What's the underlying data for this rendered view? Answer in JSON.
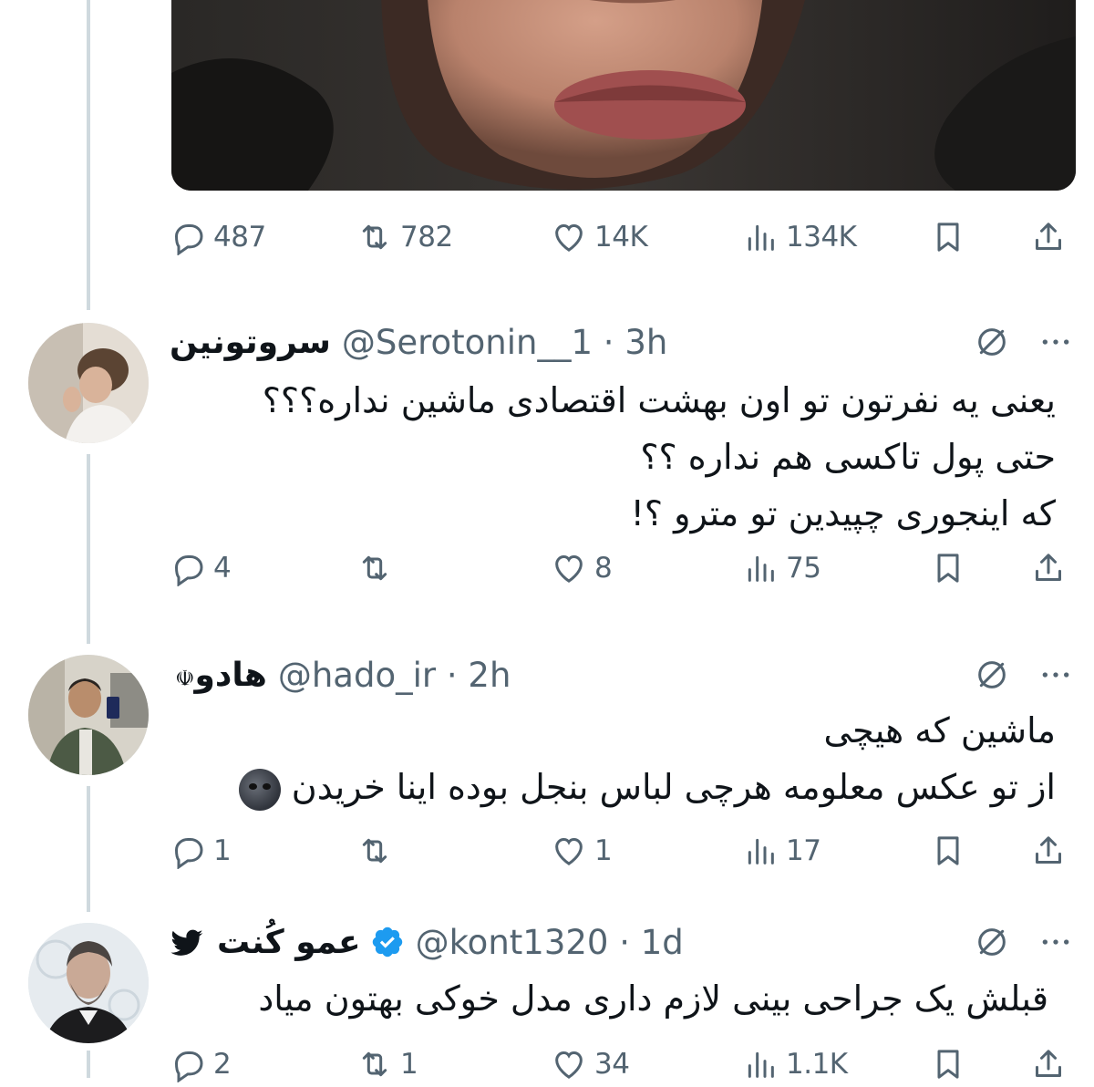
{
  "top_tweet": {
    "stats": {
      "replies": "487",
      "retweets": "782",
      "likes": "14K",
      "views": "134K"
    }
  },
  "replies": [
    {
      "display_name": "سروتونین",
      "handle": "@Serotonin__1",
      "time": "3h",
      "lines": [
        "یعنی یه نفرتون تو اون بهشت اقتصادی ماشین نداره؟؟؟",
        "حتی پول تاکسی هم نداره ؟؟",
        "که اینجوری چپیدین تو مترو ؟!"
      ],
      "stats": {
        "replies": "4",
        "retweets": "",
        "likes": "8",
        "views": "75"
      }
    },
    {
      "display_name": "هادو",
      "handle": "@hado_ir",
      "time": "2h",
      "name_emoji": "☫",
      "lines": [
        "ماشین که هیچی",
        "از تو عکس معلومه هرچی لباس بنجل بوده اینا خریدن"
      ],
      "stats": {
        "replies": "1",
        "retweets": "",
        "likes": "1",
        "views": "17"
      }
    },
    {
      "display_name": "عمو کُنت",
      "handle": "@kont1320",
      "time": "1d",
      "verified": true,
      "lines": [
        "قبلش یک جراحی بینی لازم داری مدل خوکی بهتون میاد"
      ],
      "stats": {
        "replies": "2",
        "retweets": "1",
        "likes": "34",
        "views": "1.1K"
      }
    }
  ],
  "colors": {
    "text_primary": "#0f1419",
    "text_secondary": "#536471",
    "verified_blue": "#1d9bf0",
    "thread_line": "#cfd9de"
  }
}
